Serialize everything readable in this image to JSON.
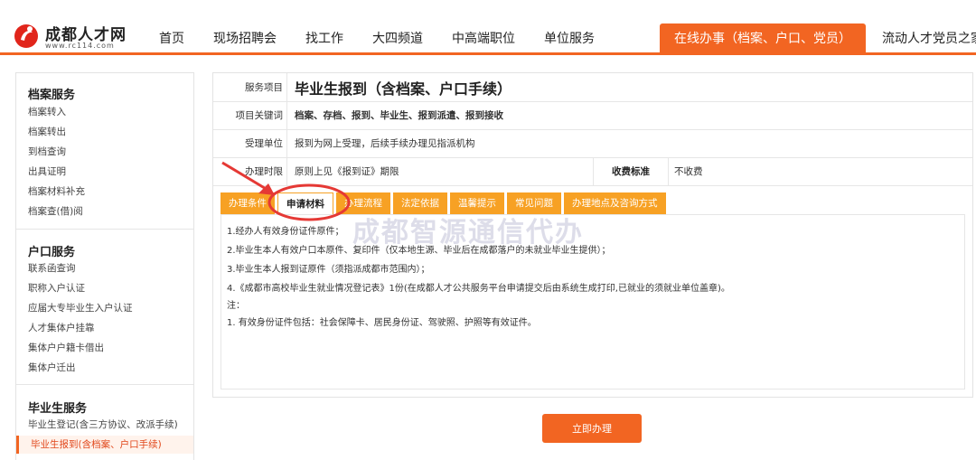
{
  "brand": {
    "title": "成都人才网",
    "url": "www.rc114.com"
  },
  "nav": [
    {
      "label": "首页"
    },
    {
      "label": "现场招聘会"
    },
    {
      "label": "找工作"
    },
    {
      "label": "大四频道"
    },
    {
      "label": "中高端职位"
    },
    {
      "label": "单位服务"
    },
    {
      "label": "在线办事（档案、户口、党员）"
    },
    {
      "label": "流动人才党员之家"
    }
  ],
  "sidebar": {
    "groups": [
      {
        "title": "档案服务",
        "items": [
          "档案转入",
          "档案转出",
          "到档查询",
          "出具证明",
          "档案材料补充",
          "档案查(借)阅"
        ]
      },
      {
        "title": "户口服务",
        "items": [
          "联系函查询",
          "职称入户认证",
          "应届大专毕业生入户认证",
          "人才集体户挂靠",
          "集体户户籍卡借出",
          "集体户迁出"
        ]
      },
      {
        "title": "毕业生服务",
        "items": [
          "毕业生登记(含三方协议、改派手续)",
          "毕业生报到(含档案、户口手续)"
        ]
      }
    ]
  },
  "info": {
    "service_label": "服务项目",
    "service_value": "毕业生报到（含档案、户口手续）",
    "keywords_label": "项目关键词",
    "keywords_value": "档案、存档、报到、毕业生、报到派遣、报到接收",
    "unit_label": "受理单位",
    "unit_value": "报到为网上受理，后续手续办理见指派机构",
    "time_label": "办理时限",
    "time_value": "原则上见《报到证》期限",
    "fee_label": "收费标准",
    "fee_value": "不收费"
  },
  "tabs": [
    {
      "label": "办理条件"
    },
    {
      "label": "申请材料"
    },
    {
      "label": "办理流程"
    },
    {
      "label": "法定依据"
    },
    {
      "label": "温馨提示"
    },
    {
      "label": "常见问题"
    },
    {
      "label": "办理地点及咨询方式"
    }
  ],
  "materials": [
    "1.经办人有效身份证件原件；",
    "2.毕业生本人有效户口本原件、复印件（仅本地生源、毕业后在成都落户的未就业毕业生提供）；",
    "3.毕业生本人报到证原件（须指派成都市范围内）；",
    "4.《成都市高校毕业生就业情况登记表》1份(在成都人才公共服务平台申请提交后由系统生成打印,已就业的须就业单位盖章)。",
    "注：",
    "1. 有效身份证件包括：社会保障卡、居民身份证、驾驶照、护照等有效证件。"
  ],
  "submit_label": "立即办理",
  "watermark": "成都智源通信代办",
  "colors": {
    "accent": "#f26522",
    "tab": "#f7a124",
    "annotation": "#e53935"
  }
}
